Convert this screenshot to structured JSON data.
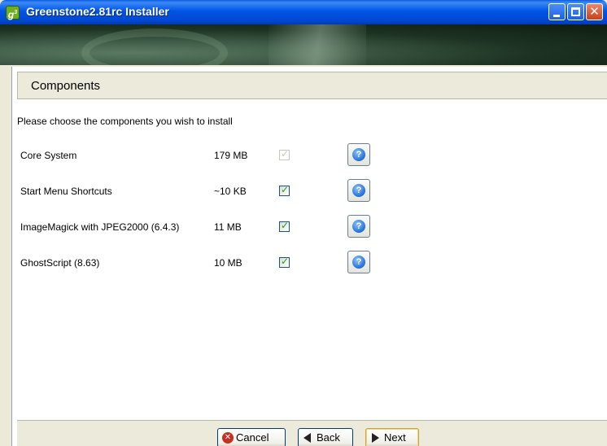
{
  "window": {
    "title": "Greenstone2.81rc Installer",
    "icon_label": "g",
    "icon_sup": "3"
  },
  "page": {
    "header": "Components",
    "prompt": "Please choose the components you wish to install"
  },
  "components": [
    {
      "name": "Core System",
      "size": "179 MB",
      "checked": true,
      "disabled": true
    },
    {
      "name": "Start Menu Shortcuts",
      "size": "~10 KB",
      "checked": true,
      "disabled": false
    },
    {
      "name": "ImageMagick with JPEG2000 (6.4.3)",
      "size": "11 MB",
      "checked": true,
      "disabled": false
    },
    {
      "name": "GhostScript (8.63)",
      "size": "10 MB",
      "checked": true,
      "disabled": false
    }
  ],
  "buttons": {
    "cancel": "Cancel",
    "back": "Back",
    "next": "Next"
  },
  "icons": {
    "help": "help-icon",
    "cancel": "cancel-icon",
    "back": "back-arrow-icon",
    "next": "next-arrow-icon"
  },
  "colors": {
    "titlebar": "#0055e5",
    "panel_bg": "#ebeadb",
    "check": "#21a121",
    "help": "#1f6fd8"
  }
}
